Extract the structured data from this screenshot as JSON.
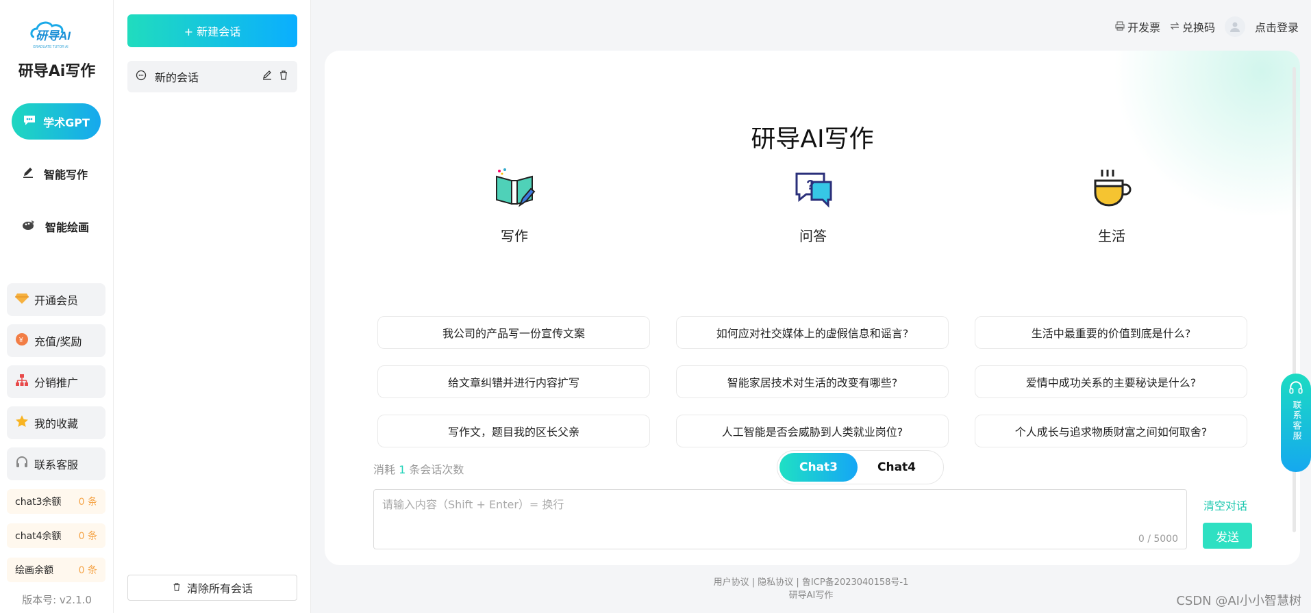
{
  "nav": {
    "logo_text": "研导AI",
    "logo_subtext": "GRADUATE TUTOR AI",
    "brand": "研导Ai写作",
    "primary": [
      {
        "label": "学术GPT",
        "icon": "chat-bubble-icon"
      },
      {
        "label": "智能写作",
        "icon": "pen-icon"
      },
      {
        "label": "智能绘画",
        "icon": "palette-icon"
      }
    ],
    "menu": [
      {
        "label": "开通会员",
        "icon": "diamond-icon"
      },
      {
        "label": "充值/奖励",
        "icon": "coin-icon"
      },
      {
        "label": "分销推广",
        "icon": "org-chart-icon"
      },
      {
        "label": "我的收藏",
        "icon": "star-icon"
      },
      {
        "label": "联系客服",
        "icon": "headset-icon"
      }
    ],
    "quotas": [
      {
        "label": "chat3余额",
        "value": "0 条"
      },
      {
        "label": "chat4余额",
        "value": "0 条"
      },
      {
        "label": "绘画余额",
        "value": "0 条"
      }
    ],
    "version": "版本号: v2.1.0"
  },
  "conversations": {
    "new_label": "+ 新建会话",
    "items": [
      {
        "title": "新的会话"
      }
    ],
    "clear_label": "清除所有会话"
  },
  "topbar": {
    "invoice": "开发票",
    "redeem": "兑换码",
    "login": "点击登录"
  },
  "main": {
    "title": "研导AI写作",
    "columns": [
      {
        "heading": "写作",
        "prompts": [
          "我公司的产品写一份宣传文案",
          "给文章纠错并进行内容扩写",
          "写作文，题目我的区长父亲"
        ]
      },
      {
        "heading": "问答",
        "prompts": [
          "如何应对社交媒体上的虚假信息和谣言?",
          "智能家居技术对生活的改变有哪些?",
          "人工智能是否会威胁到人类就业岗位?"
        ]
      },
      {
        "heading": "生活",
        "prompts": [
          "生活中最重要的价值到底是什么?",
          "爱情中成功关系的主要秘诀是什么?",
          "个人成长与追求物质财富之间如何取舍?"
        ]
      }
    ],
    "consume_prefix": "消耗",
    "consume_count": "1",
    "consume_suffix": "条会话次数",
    "models": [
      "Chat3",
      "Chat4"
    ],
    "active_model": "Chat3",
    "input_placeholder": "请输入内容（Shift + Enter）= 换行",
    "char_count": "0 / 5000",
    "clear_chat": "清空对话",
    "send": "发送"
  },
  "footer": {
    "line1": "用户协议 | 隐私协议 | 鲁ICP备2023040158号-1",
    "line2": "研导AI写作",
    "watermark": "CSDN @AI小小智慧树"
  },
  "service": {
    "label": "联系客服"
  },
  "colors": {
    "accent_start": "#1fd7c0",
    "accent_end": "#16a8ee",
    "quota_value": "#f5a54a"
  }
}
